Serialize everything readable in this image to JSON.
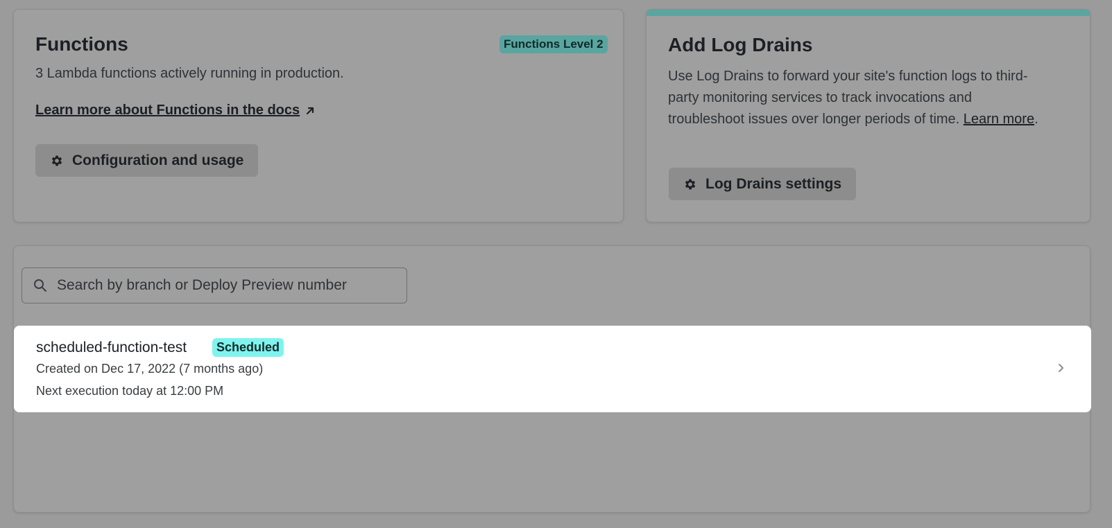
{
  "functions": {
    "title": "Functions",
    "badge": "Functions Level 2",
    "description": "3 Lambda functions actively running in production.",
    "docs_link": "Learn more about Functions in the docs",
    "config_button": "Configuration and usage"
  },
  "log_drains": {
    "title": "Add Log Drains",
    "description_line1": "Use Log Drains to forward your site's function logs to third-",
    "description_line2": "party monitoring services to track invocations and",
    "description_line3": "troubleshoot issues over longer periods of time.",
    "learn_more": "Learn more",
    "period": ".",
    "settings_button": "Log Drains settings",
    "accent_color": "#5aa5a0"
  },
  "list": {
    "search_placeholder": "Search by branch or Deploy Preview number",
    "items": [
      {
        "name": "scheduled-function-test",
        "badge": "Scheduled",
        "created": "Created on Dec 17, 2022 (7 months ago)",
        "next_execution": "Next execution today at 12:00 PM"
      }
    ]
  }
}
